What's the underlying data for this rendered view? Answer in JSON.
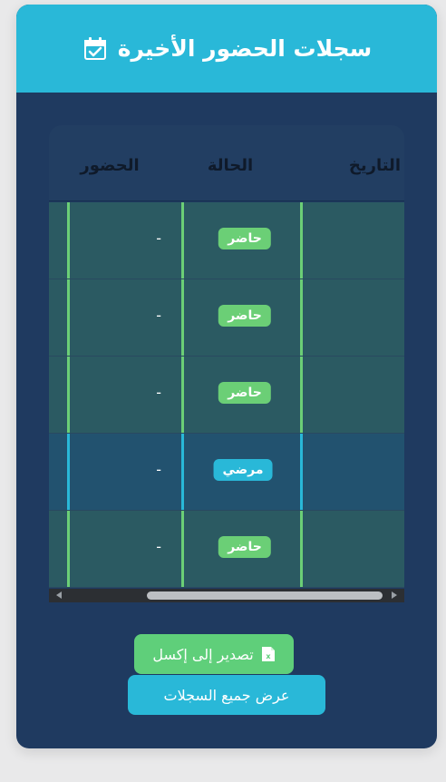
{
  "card": {
    "title": "سجلات الحضور الأخيرة",
    "icon": "calendar-check-icon"
  },
  "table": {
    "headers": {
      "date": "التاريخ",
      "status": "الحالة",
      "attendance": "الحضور"
    },
    "rows": [
      {
        "status": "حاضر",
        "type": "present",
        "attendance": "-"
      },
      {
        "status": "حاضر",
        "type": "present",
        "attendance": "-"
      },
      {
        "status": "حاضر",
        "type": "present",
        "attendance": "-"
      },
      {
        "status": "مرضي",
        "type": "sick",
        "attendance": "-"
      },
      {
        "status": "حاضر",
        "type": "present",
        "attendance": "-"
      }
    ]
  },
  "buttons": {
    "export_label": "تصدير إلى إكسل",
    "export_icon": "excel-file-icon",
    "view_all_label": "عرض جميع السجلات"
  },
  "colors": {
    "header": "#29b8d8",
    "card": "#1f3a60",
    "present": "#6bcf76",
    "sick": "#29b8d8"
  }
}
